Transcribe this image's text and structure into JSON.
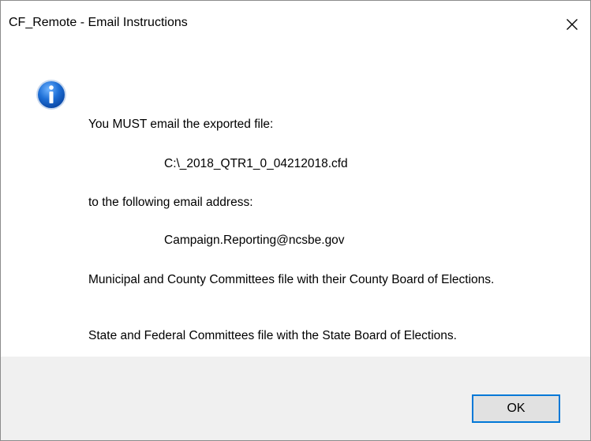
{
  "window": {
    "title": "CF_Remote - Email Instructions",
    "close_glyph": "✕"
  },
  "icon": {
    "type": "info-icon",
    "color": "#1e6fd6"
  },
  "message": {
    "line1": "You MUST email the exported file:",
    "file_path": "C:\\_2018_QTR1_0_04212018.cfd",
    "line2": "to the following email address:",
    "email": "Campaign.Reporting@ncsbe.gov",
    "line3": "Municipal and County Committees file with their County Board of Elections.",
    "line4": "State and Federal Committees file with the State Board of Elections."
  },
  "buttons": {
    "ok_label": "OK"
  }
}
